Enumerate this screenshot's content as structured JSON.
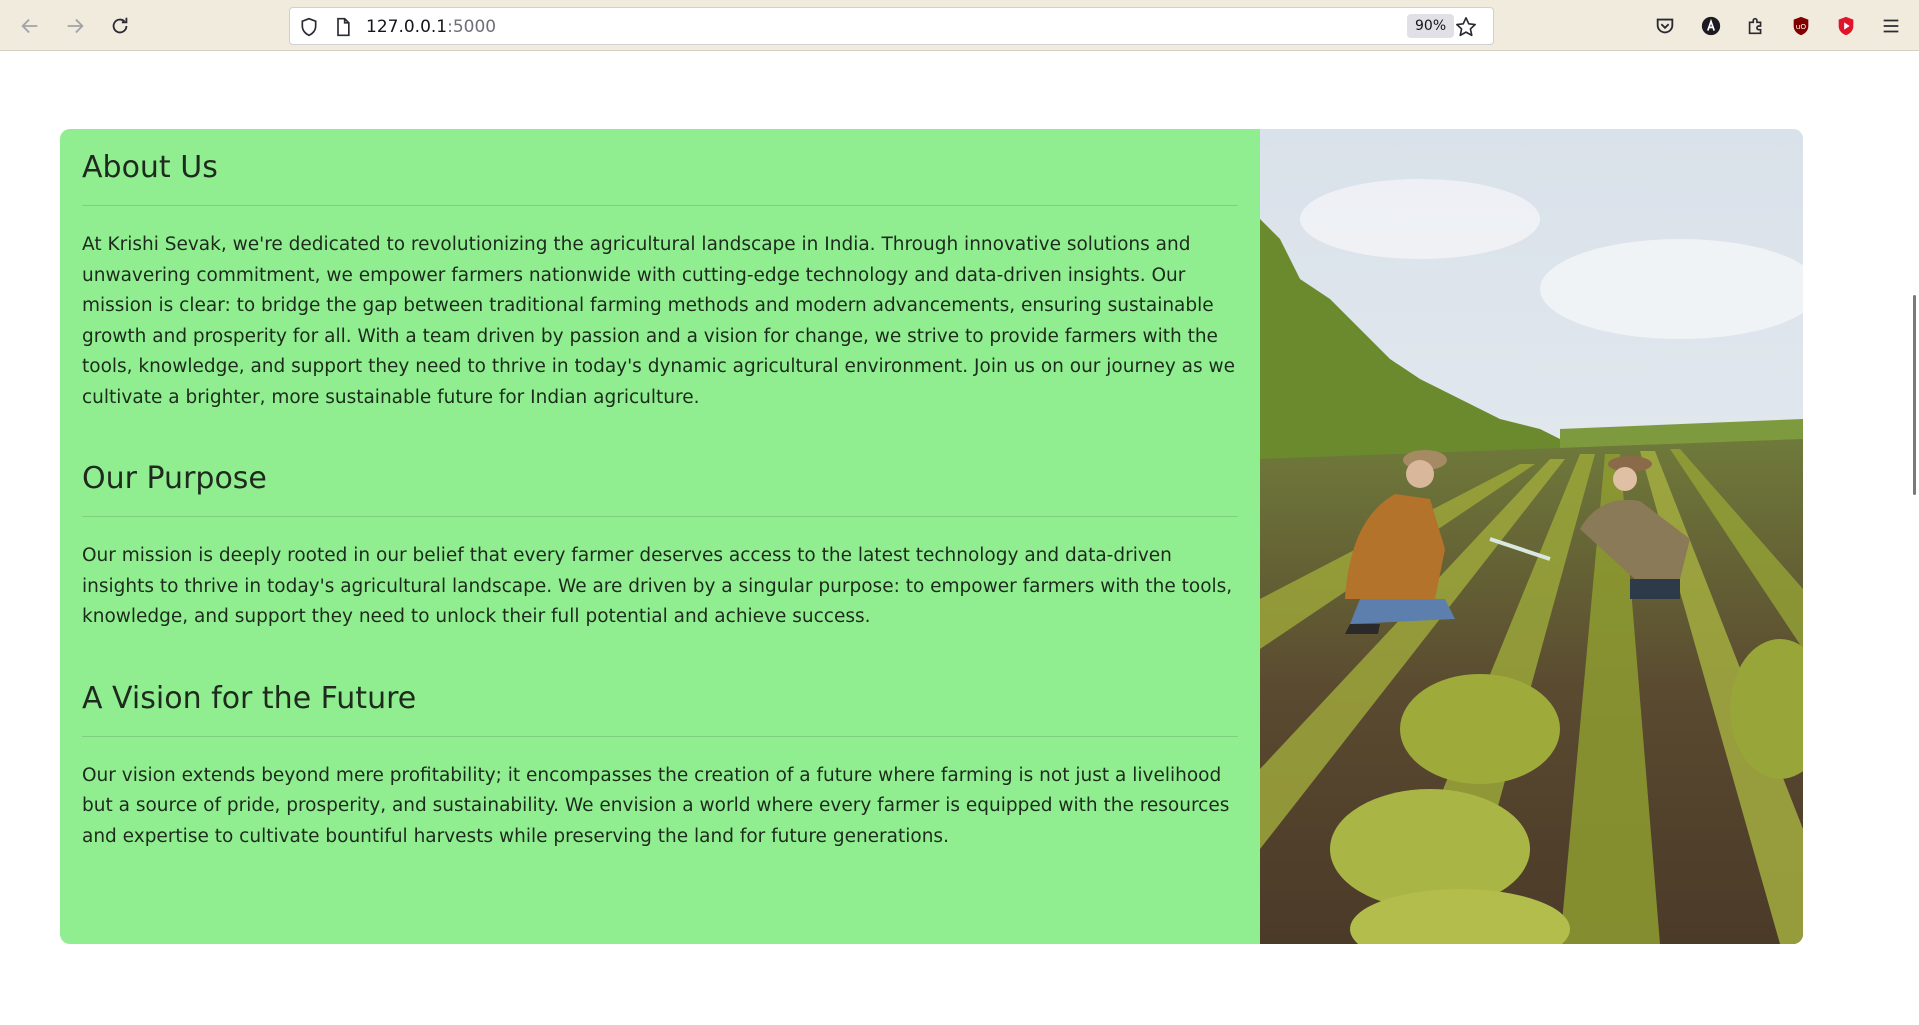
{
  "browser": {
    "url_host": "127.0.0.1",
    "url_port": ":5000",
    "zoom": "90%"
  },
  "about": {
    "title": "About Us",
    "body": "At Krishi Sevak, we're dedicated to revolutionizing the agricultural landscape in India. Through innovative solutions and unwavering commitment, we empower farmers nationwide with cutting-edge technology and data-driven insights. Our mission is clear: to bridge the gap between traditional farming methods and modern advancements, ensuring sustainable growth and prosperity for all. With a team driven by passion and a vision for change, we strive to provide farmers with the tools, knowledge, and support they need to thrive in today's dynamic agricultural environment. Join us on our journey as we cultivate a brighter, more sustainable future for Indian agriculture."
  },
  "purpose": {
    "title": "Our Purpose",
    "body": "Our mission is deeply rooted in our belief that every farmer deserves access to the latest technology and data-driven insights to thrive in today's agricultural landscape. We are driven by a singular purpose: to empower farmers with the tools, knowledge, and support they need to unlock their full potential and achieve success."
  },
  "vision": {
    "title": "A Vision for the Future",
    "body": "Our vision extends beyond mere profitability; it encompasses the creation of a future where farming is not just a livelihood but a source of pride, prosperity, and sustainability. We envision a world where every farmer is equipped with the resources and expertise to cultivate bountiful harvests while preserving the land for future generations."
  },
  "colors": {
    "card_background": "#90ee90",
    "toolbar_background": "#f0ebdd"
  }
}
